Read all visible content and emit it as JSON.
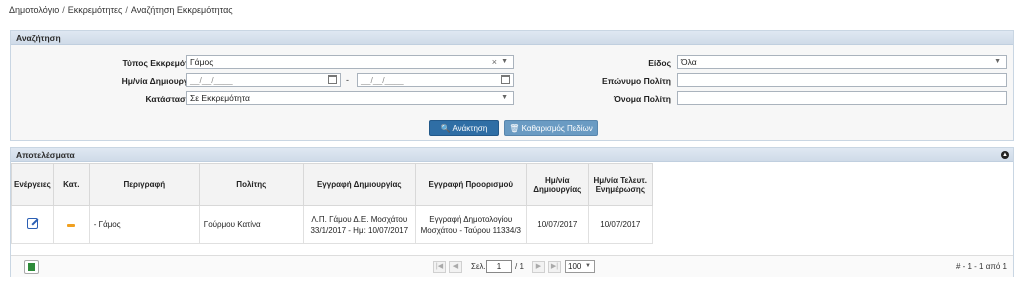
{
  "breadcrumb": {
    "items": [
      "Δημοτολόγιο",
      "Εκκρεμότητες",
      "Αναζήτηση Εκκρεμότητας"
    ],
    "separator": "/"
  },
  "search": {
    "title": "Αναζήτηση",
    "type_label": "Τύπος Εκκρεμότ.",
    "type_value": "Γάμος",
    "date_label": "Ημ/νία Δημιουργ.",
    "date_from_placeholder": "__/__/____",
    "date_to_placeholder": "__/__/____",
    "date_separator": "-",
    "status_label": "Κατάσταση",
    "status_value": "Σε Εκκρεμότητα",
    "kind_label": "Είδος",
    "kind_value": "Όλα",
    "surname_label": "Επώνυμο Πολίτη",
    "surname_value": "",
    "name_label": "Όνομα Πολίτη",
    "name_value": "",
    "search_button": "Ανάκτηση",
    "clear_button": "Καθαρισμός Πεδίων"
  },
  "results": {
    "title": "Αποτελέσματα",
    "columns": [
      "Ενέργειες",
      "Κατ.",
      "Περιγραφή",
      "Πολίτης",
      "Εγγραφή Δημιουργίας",
      "Εγγραφή Προορισμού",
      "Ημ/νία Δημιουργίας",
      "Ημ/νία Τελευτ. Ενημέρωσης"
    ],
    "rows": [
      {
        "description": "- Γάμος",
        "citizen": "Γούρμου Κατίνα",
        "creation_entry": "Λ.Π. Γάμου Δ.Ε. Μοσχάτου 33/1/2017 - Ημ: 10/07/2017",
        "destination_entry": "Εγγραφή Δημοτολογίου Μοσχάτου - Ταύρου 11334/3",
        "created_date": "10/07/2017",
        "updated_date": "10/07/2017"
      }
    ],
    "pager": {
      "page_label": "Σελ.",
      "page_value": "1",
      "page_total": "/ 1",
      "page_size": "100",
      "info": "# - 1 - 1 από 1"
    }
  },
  "colors": {
    "panel_header": "#cfdbe8",
    "primary_button": "#2f6ea5",
    "secondary_button": "#6a9bc3",
    "status_pending": "#f0a020"
  }
}
